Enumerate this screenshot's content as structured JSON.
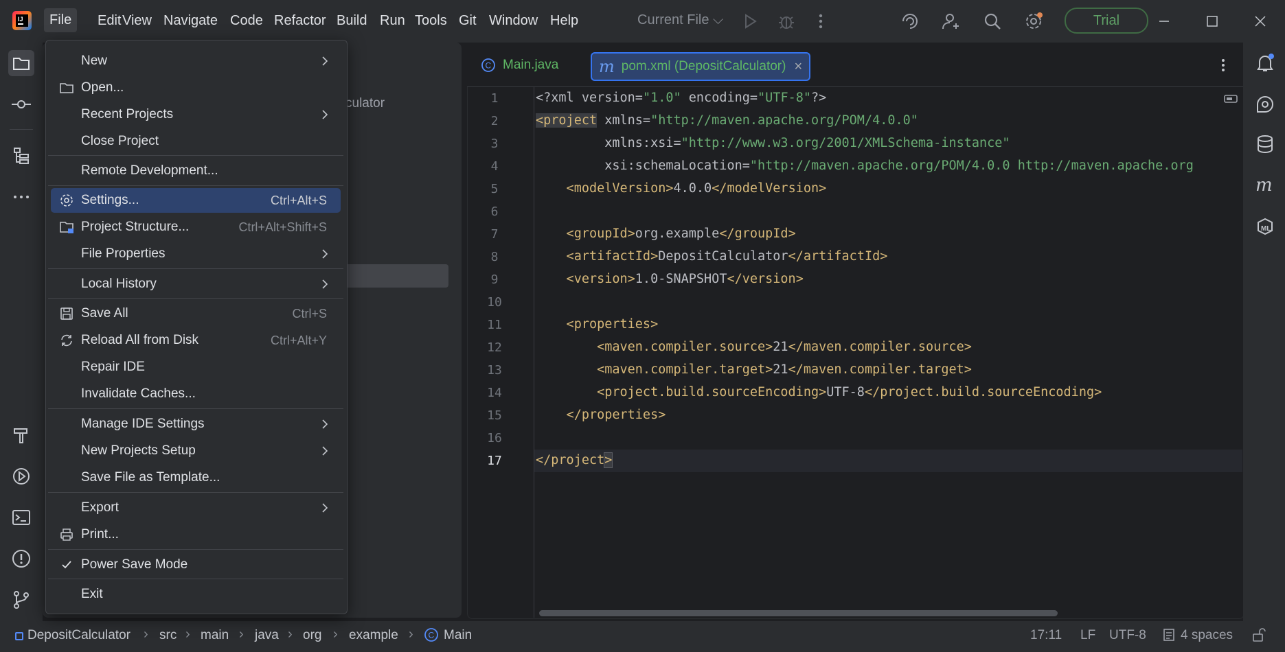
{
  "menubar": {
    "items": [
      "File",
      "Edit",
      "View",
      "Navigate",
      "Code",
      "Refactor",
      "Build",
      "Run",
      "Tools",
      "Git",
      "Window",
      "Help"
    ],
    "run_config": "Current File ⌵",
    "trial": "Trial"
  },
  "project_panel": {
    "hint_text": "culator"
  },
  "file_menu": {
    "items": [
      {
        "label": "New"
      },
      {
        "label": "Open..."
      },
      {
        "label": "Recent Projects"
      },
      {
        "label": "Close Project"
      },
      {
        "label": "Remote Development..."
      },
      {
        "label": "Settings...",
        "shortcut": "Ctrl+Alt+S"
      },
      {
        "label": "Project Structure...",
        "shortcut": "Ctrl+Alt+Shift+S"
      },
      {
        "label": "File Properties"
      },
      {
        "label": "Local History"
      },
      {
        "label": "Save All",
        "shortcut": "Ctrl+S"
      },
      {
        "label": "Reload All from Disk",
        "shortcut": "Ctrl+Alt+Y"
      },
      {
        "label": "Repair IDE"
      },
      {
        "label": "Invalidate Caches..."
      },
      {
        "label": "Manage IDE Settings"
      },
      {
        "label": "New Projects Setup"
      },
      {
        "label": "Save File as Template..."
      },
      {
        "label": "Export"
      },
      {
        "label": "Print..."
      },
      {
        "label": "Power Save Mode",
        "checked": true
      },
      {
        "label": "Exit"
      }
    ]
  },
  "editor": {
    "tabs": [
      {
        "label": "Main.java"
      },
      {
        "label": "pom.xml (DepositCalculator)",
        "close": "×"
      }
    ],
    "line_numbers": [
      "1",
      "2",
      "3",
      "4",
      "5",
      "6",
      "7",
      "8",
      "9",
      "10",
      "11",
      "12",
      "13",
      "14",
      "15",
      "16",
      "17"
    ],
    "lines": {
      "l1": {
        "a": "<?xml version=",
        "b": "\"1.0\"",
        "c": " encoding=",
        "d": "\"UTF-8\"",
        "e": "?>"
      },
      "l2": {
        "a": "<project",
        "b": " xmlns=",
        "c": "\"http://maven.apache.org/POM/4.0.0\""
      },
      "l3": {
        "a": "         xmlns:xsi=",
        "b": "\"http://www.w3.org/2001/XMLSchema-instance\""
      },
      "l4": {
        "a": "         xsi:schemaLocation=",
        "b": "\"http://maven.apache.org/POM/4.0.0 http://maven.apache.org"
      },
      "l5": {
        "a": "    <modelVersion>",
        "b": "4.0.0",
        "c": "</modelVersion>"
      },
      "l7": {
        "a": "    <groupId>",
        "b": "org.example",
        "c": "</groupId>"
      },
      "l8": {
        "a": "    <artifactId>",
        "b": "DepositCalculator",
        "c": "</artifactId>"
      },
      "l9": {
        "a": "    <version>",
        "b": "1.0-SNAPSHOT",
        "c": "</version>"
      },
      "l11": {
        "a": "    <properties>"
      },
      "l12": {
        "a": "        <maven.compiler.source>",
        "b": "21",
        "c": "</maven.compiler.source>"
      },
      "l13": {
        "a": "        <maven.compiler.target>",
        "b": "21",
        "c": "</maven.compiler.target>"
      },
      "l14": {
        "a": "        <project.build.sourceEncoding>",
        "b": "UTF-8",
        "c": "</project.build.sourceEncoding>"
      },
      "l15": {
        "a": "    </properties>"
      },
      "l17": {
        "a": "</project",
        "b": ">"
      }
    }
  },
  "statusbar": {
    "breadcrumbs": [
      "DepositCalculator",
      "src",
      "main",
      "java",
      "org",
      "example",
      "Main"
    ],
    "position": "17:11",
    "line_sep": "LF",
    "encoding": "UTF-8",
    "indent": "4 spaces"
  }
}
